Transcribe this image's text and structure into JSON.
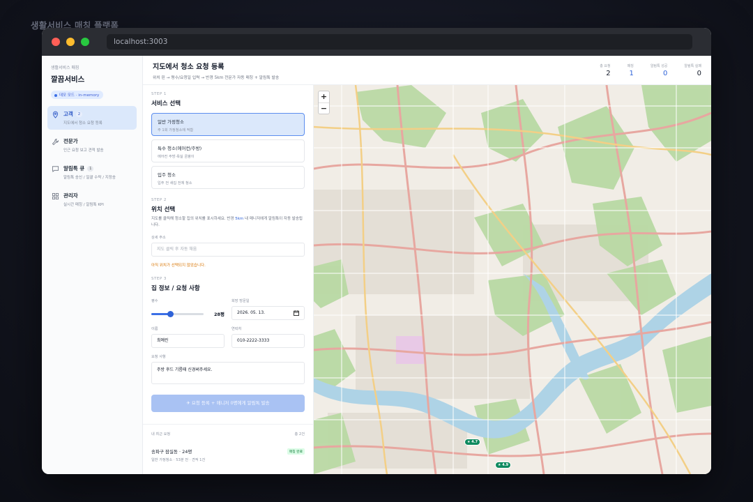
{
  "page_caption": "생활서비스 매칭 플랫폼",
  "browser": {
    "url": "localhost:3003"
  },
  "sidebar": {
    "brand_sub": "생활서비스 매칭",
    "brand_title": "깔끔서비스",
    "mode_badge": "데모 모드 · in-memory",
    "items": [
      {
        "label": "고객",
        "count": "2",
        "desc": "지도에서 청소 요청 등록",
        "icon": "map-pin-icon",
        "active": true
      },
      {
        "label": "전문가",
        "count": "",
        "desc": "인근 요청 보고 견적 발송",
        "icon": "wrench-icon",
        "active": false
      },
      {
        "label": "알림톡 큐",
        "count": "1",
        "desc": "알림톡 송신 / 일괄 수락 / 지정송",
        "icon": "chat-icon",
        "active": false
      },
      {
        "label": "관리자",
        "count": "",
        "desc": "실시간 매칭 / 알림톡 KPI",
        "icon": "grid-icon",
        "active": false
      }
    ]
  },
  "header": {
    "title": "지도에서 청소 요청 등록",
    "subtitle": "위치 핀 → 평수/요청일 입력 → 반경 5km 전문가 자동 매칭 + 알림톡 발송",
    "stats": [
      {
        "label": "총 요청",
        "value": "2",
        "blue": false
      },
      {
        "label": "매칭",
        "value": "1",
        "blue": true
      },
      {
        "label": "알림톡 성공",
        "value": "0",
        "blue": true
      },
      {
        "label": "알림톡 실패",
        "value": "0",
        "blue": false
      }
    ]
  },
  "form": {
    "step1": {
      "label": "STEP 1",
      "title": "서비스 선택"
    },
    "services": [
      {
        "name": "일반 가정청소",
        "desc": "주 1회 가정청소에 적합",
        "selected": true
      },
      {
        "name": "특수 청소(에어컨/주방)",
        "desc": "에어컨 주방·욕실 곰팡이",
        "selected": false
      },
      {
        "name": "입주 청소",
        "desc": "입주 전 새집 전체 청소",
        "selected": false
      }
    ],
    "step2": {
      "label": "STEP 2",
      "title": "위치 선택",
      "help_before": "지도를 클릭해 청소할 집의 위치를 표시하세요. 반경 ",
      "help_highlight": "5km",
      "help_after": " 내 매니저에게 알림톡이 자동 발송됩니다."
    },
    "address": {
      "label": "상세 주소",
      "placeholder": "지도 클릭 후 자동 채움"
    },
    "location_warning": "아직 위치가 선택되지 않았습니다.",
    "step3": {
      "label": "STEP 3",
      "title": "집 정보 / 요청 사항"
    },
    "area": {
      "label": "평수",
      "value_text": "28평",
      "value": 28,
      "min": 10,
      "max": 60
    },
    "date": {
      "label": "희망 방문일",
      "value": "2026. 05. 13."
    },
    "name": {
      "label": "이름",
      "value": "최예린"
    },
    "phone": {
      "label": "연락처",
      "value": "010-2222-3333"
    },
    "request": {
      "label": "요청 사항",
      "value": "주방 후드 기름때 신경써주세요."
    },
    "submit_label": "요청 등록 + 매니저 0명에게 알림톡 발송"
  },
  "recent": {
    "title": "내 최근 요청",
    "count": "총 2건",
    "items": [
      {
        "title": "송파구 잠실동 · 24평",
        "badge": "매칭 완료",
        "sub": "일반 가정청소 · 53분 전 · 견적 1건"
      }
    ]
  },
  "map": {
    "zoom_in": "+",
    "zoom_out": "−",
    "pins": [
      "★ 4.7",
      "★ 4.9"
    ]
  }
}
